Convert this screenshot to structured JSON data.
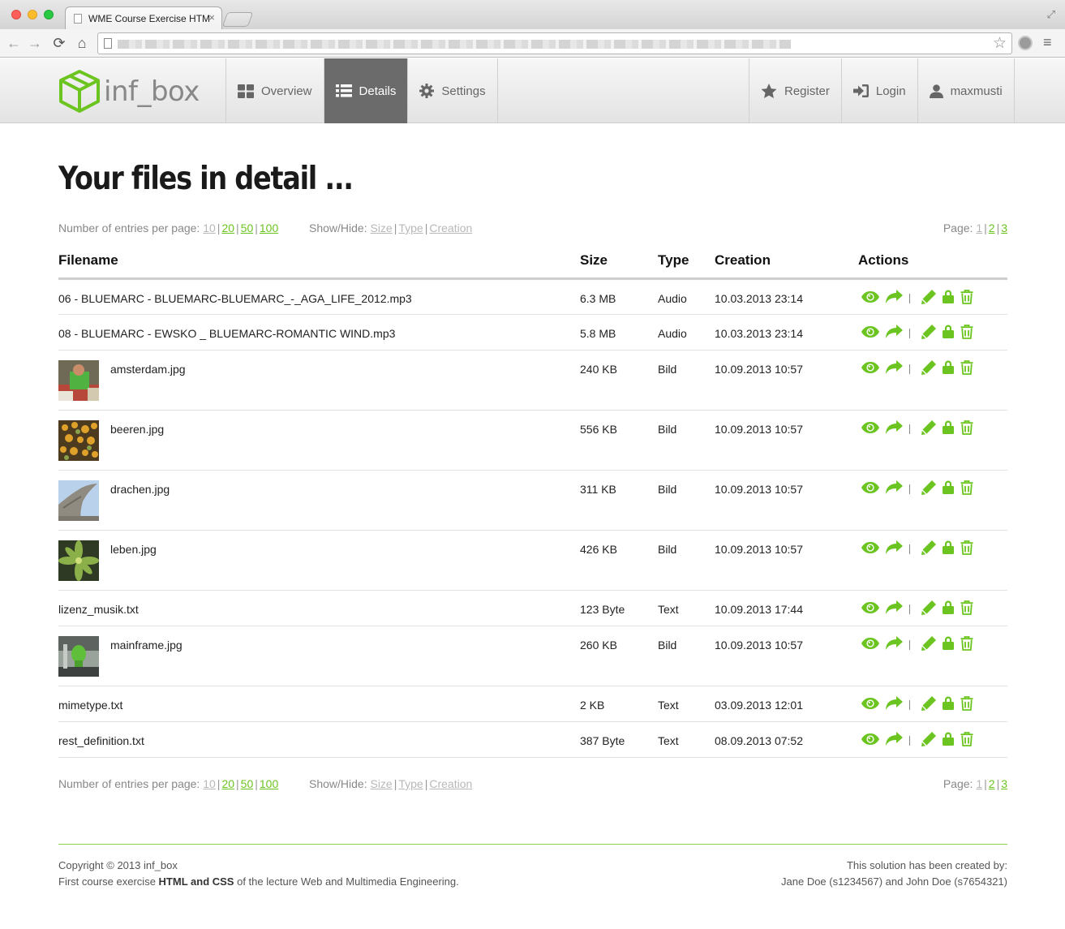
{
  "browser": {
    "tab_title": "WME Course Exercise HTM",
    "tab_close": "×",
    "nav_back": "←",
    "nav_forward": "→",
    "nav_reload": "⟳",
    "nav_home": "⌂",
    "bookmark": "☆",
    "menu": "≡",
    "resize": "⤢"
  },
  "site": {
    "logo_text": "inf_box",
    "nav_left": [
      {
        "label": "Overview",
        "icon": "grid-icon",
        "active": false
      },
      {
        "label": "Details",
        "icon": "list-icon",
        "active": true
      },
      {
        "label": "Settings",
        "icon": "gear-icon",
        "active": false
      }
    ],
    "nav_right": [
      {
        "label": "Register",
        "icon": "star-icon"
      },
      {
        "label": "Login",
        "icon": "login-icon"
      },
      {
        "label": "maxmusti",
        "icon": "user-icon"
      }
    ]
  },
  "page": {
    "title": "Your files in detail ..."
  },
  "controls": {
    "entries_label": "Number of entries per page:",
    "entries_options": [
      "10",
      "20",
      "50",
      "100"
    ],
    "showhide_label": "Show/Hide:",
    "showhide_options": [
      "Size",
      "Type",
      "Creation"
    ],
    "page_label": "Page:",
    "pages": [
      "1",
      "2",
      "3"
    ]
  },
  "table": {
    "headers": {
      "filename": "Filename",
      "size": "Size",
      "type": "Type",
      "creation": "Creation",
      "actions": "Actions"
    },
    "rows": [
      {
        "name": "06 - BLUEMARC - BLUEMARC-BLUEMARC_-_AGA_LIFE_2012.mp3",
        "size": "6.3 MB",
        "type": "Audio",
        "created": "10.03.2013 23:14",
        "thumb": null
      },
      {
        "name": "08 - BLUEMARC - EWSKO _ BLUEMARC-ROMANTIC WIND.mp3",
        "size": "5.8 MB",
        "type": "Audio",
        "created": "10.03.2013 23:14",
        "thumb": null
      },
      {
        "name": "amsterdam.jpg",
        "size": "240 KB",
        "type": "Bild",
        "created": "10.09.2013 10:57",
        "thumb": "amsterdam"
      },
      {
        "name": "beeren.jpg",
        "size": "556 KB",
        "type": "Bild",
        "created": "10.09.2013 10:57",
        "thumb": "beeren"
      },
      {
        "name": "drachen.jpg",
        "size": "311 KB",
        "type": "Bild",
        "created": "10.09.2013 10:57",
        "thumb": "drachen"
      },
      {
        "name": "leben.jpg",
        "size": "426 KB",
        "type": "Bild",
        "created": "10.09.2013 10:57",
        "thumb": "leben"
      },
      {
        "name": "lizenz_musik.txt",
        "size": "123 Byte",
        "type": "Text",
        "created": "10.09.2013 17:44",
        "thumb": null
      },
      {
        "name": "mainframe.jpg",
        "size": "260 KB",
        "type": "Bild",
        "created": "10.09.2013 10:57",
        "thumb": "mainframe"
      },
      {
        "name": "mimetype.txt",
        "size": "2 KB",
        "type": "Text",
        "created": "03.09.2013 12:01",
        "thumb": null
      },
      {
        "name": "rest_definition.txt",
        "size": "387 Byte",
        "type": "Text",
        "created": "08.09.2013 07:52",
        "thumb": null
      }
    ],
    "action_icons": [
      "eye-icon",
      "share-icon",
      "edit-icon",
      "lock-icon",
      "trash-icon"
    ]
  },
  "footer": {
    "copyright": "Copyright © 2013 inf_box",
    "course_prefix": "First course exercise ",
    "course_bold": "HTML and CSS",
    "course_suffix": " of the lecture Web and Multimedia Engineering.",
    "created_by": "This solution has been created by:",
    "authors": "Jane Doe (s1234567) and John Doe (s7654321)"
  },
  "colors": {
    "accent": "#6cc420",
    "nav_active": "#6b6b6b",
    "dim_link": "#b8b8b8"
  }
}
